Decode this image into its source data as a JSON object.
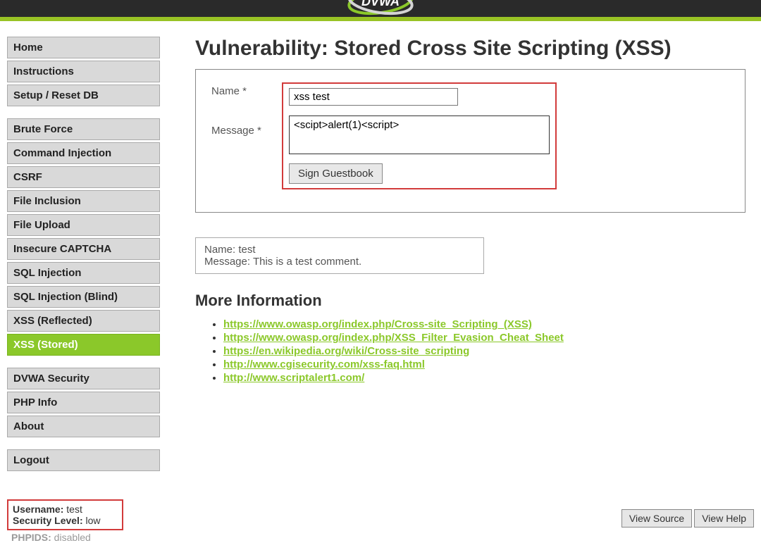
{
  "sidebar": {
    "group1": [
      {
        "label": "Home"
      },
      {
        "label": "Instructions"
      },
      {
        "label": "Setup / Reset DB"
      }
    ],
    "group2": [
      {
        "label": "Brute Force"
      },
      {
        "label": "Command Injection"
      },
      {
        "label": "CSRF"
      },
      {
        "label": "File Inclusion"
      },
      {
        "label": "File Upload"
      },
      {
        "label": "Insecure CAPTCHA"
      },
      {
        "label": "SQL Injection"
      },
      {
        "label": "SQL Injection (Blind)"
      },
      {
        "label": "XSS (Reflected)"
      },
      {
        "label": "XSS (Stored)",
        "active": true
      }
    ],
    "group3": [
      {
        "label": "DVWA Security"
      },
      {
        "label": "PHP Info"
      },
      {
        "label": "About"
      }
    ],
    "group4": [
      {
        "label": "Logout"
      }
    ]
  },
  "status": {
    "username_label": "Username:",
    "username_value": " test",
    "security_label": "Security Level:",
    "security_value": " low",
    "phpids_label": "PHPIDS:",
    "phpids_value": " disabled"
  },
  "main": {
    "title": "Vulnerability: Stored Cross Site Scripting (XSS)",
    "form": {
      "name_label": "Name *",
      "name_value": "xss test",
      "message_label": "Message *",
      "message_value": "<scipt>alert(1)<script>",
      "submit_label": "Sign Guestbook"
    },
    "entry": {
      "name_label": "Name: ",
      "name_value": "test",
      "message_label": "Message: ",
      "message_value": "This is a test comment."
    },
    "moreinfo_heading": "More Information",
    "links": [
      "https://www.owasp.org/index.php/Cross-site_Scripting_(XSS)",
      "https://www.owasp.org/index.php/XSS_Filter_Evasion_Cheat_Sheet",
      "https://en.wikipedia.org/wiki/Cross-site_scripting",
      "http://www.cgisecurity.com/xss-faq.html",
      "http://www.scriptalert1.com/"
    ]
  },
  "footer": {
    "view_source": "View Source",
    "view_help": "View Help"
  }
}
